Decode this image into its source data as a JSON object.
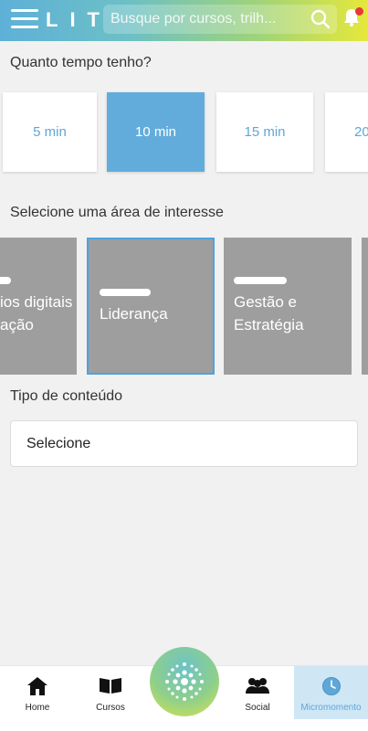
{
  "header": {
    "logo": "LIT",
    "search_placeholder": "Busque por cursos, trilh..."
  },
  "time_section": {
    "label": "Quanto tempo tenho?",
    "options": [
      "5 min",
      "10 min",
      "15 min",
      "20"
    ],
    "selected": "10 min"
  },
  "area_section": {
    "label": "Selecione uma área de interesse",
    "cards": [
      {
        "text": "ios digitais\nação"
      },
      {
        "text": "Liderança"
      },
      {
        "text": "Gestão e\nEstratégia"
      }
    ],
    "selected": "Liderança"
  },
  "content_type": {
    "label": "Tipo de conteúdo",
    "value": "Selecione"
  },
  "bottom_nav": {
    "items": [
      "Home",
      "Cursos",
      "Social",
      "Micromomento"
    ],
    "active": "Micromomento"
  },
  "colors": {
    "accent_blue": "#62acdc",
    "card_gray": "#9e9e9e",
    "notification_red": "#e53935"
  }
}
